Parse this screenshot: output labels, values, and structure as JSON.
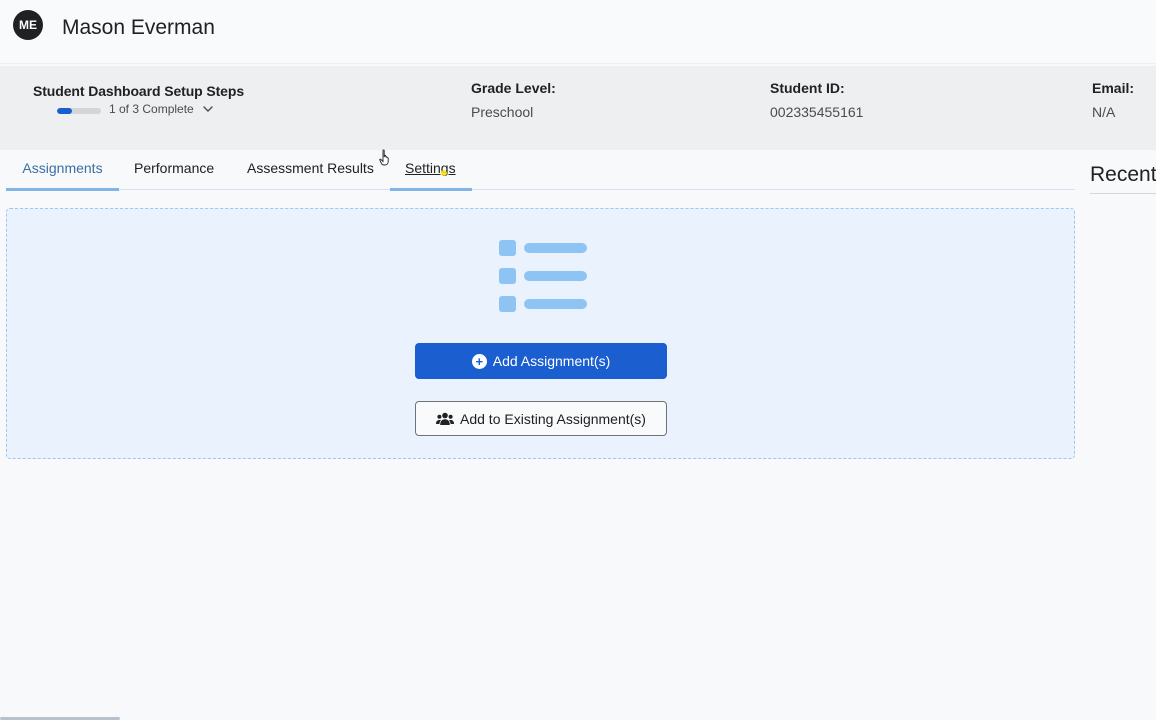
{
  "header": {
    "avatar_initials": "ME",
    "student_name": "Mason Everman"
  },
  "info": {
    "setup_title": "Student Dashboard Setup Steps",
    "setup_progress_text": "1 of 3 Complete",
    "setup_progress_fraction": 0.333,
    "grade_label": "Grade Level:",
    "grade_value": "Preschool",
    "student_id_label": "Student ID:",
    "student_id_value": "002335455161",
    "email_label": "Email:",
    "email_value": "N/A"
  },
  "tabs": [
    {
      "label": "Assignments",
      "active": true
    },
    {
      "label": "Performance",
      "active": false
    },
    {
      "label": "Assessment Results",
      "active": false
    },
    {
      "label": "Settings",
      "active": false
    }
  ],
  "side": {
    "recent_title": "Recent"
  },
  "empty_state": {
    "add_button_label": "Add Assignment(s)",
    "add_existing_button_label": "Add to Existing Assignment(s)"
  },
  "icons": {
    "avatar": "avatar",
    "chevron": "chevron-down-icon",
    "list_illustration": "list-illustration-icon",
    "plus": "plus-circle-icon",
    "users": "users-icon",
    "cursor": "hand-pointer-icon"
  },
  "colors": {
    "primary": "#1a5ecf",
    "tab_active_text": "#3a6ea5",
    "tab_underline": "#82b4ea",
    "panel_bg": "#eaf3fd",
    "illustration": "#8ec4f3"
  }
}
